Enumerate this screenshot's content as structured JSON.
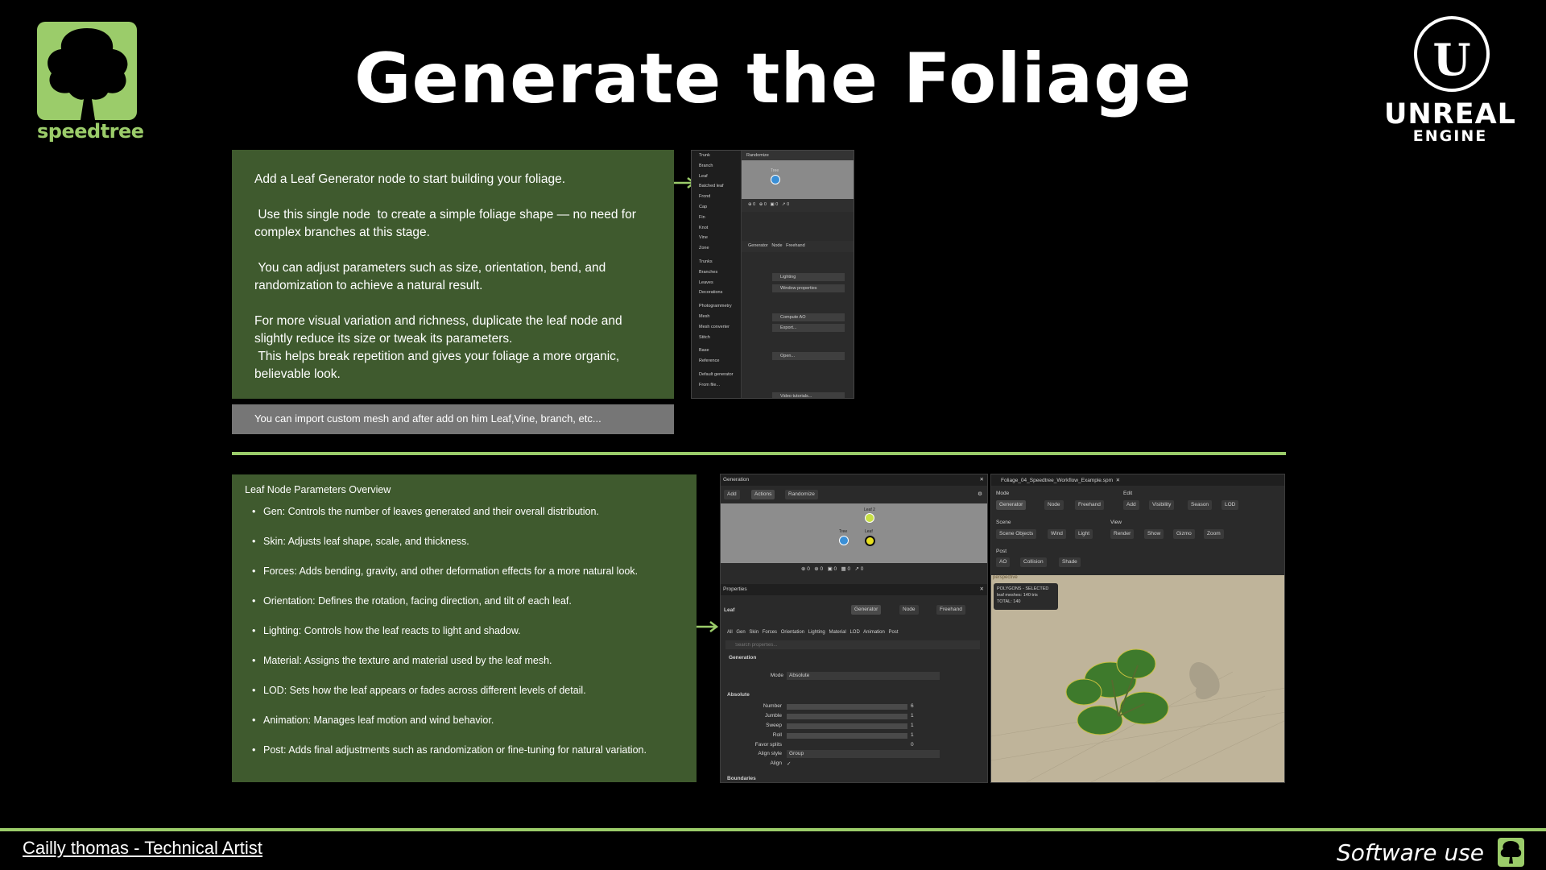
{
  "title": "Generate the Foliage",
  "logos": {
    "speedtree_word": "speedtree",
    "unreal_line1": "UNREAL",
    "unreal_line2": "ENGINE"
  },
  "panel_top": {
    "paragraphs": [
      "Add a Leaf Generator node to start building your foliage.",
      " Use this single node  to create a simple foliage shape — no need for complex branches at this stage.",
      " You can adjust parameters such as size, orientation, bend, and randomization to achieve a natural result.",
      "For more visual variation and richness, duplicate the leaf node and slightly reduce its size or tweak its parameters.\n This helps break repetition and gives your foliage a more organic, believable look."
    ],
    "note": "You can import custom mesh  and after add on him Leaf,Vine, branch, etc..."
  },
  "panel_bottom": {
    "heading": "Leaf Node Parameters Overview",
    "items": [
      "Gen: Controls the number of leaves generated and their overall distribution.",
      "Skin: Adjusts leaf shape, scale, and thickness.",
      "Forces: Adds bending, gravity, and other deformation effects for a more natural look.",
      "Orientation: Defines the rotation, facing direction, and tilt of each leaf.",
      "Lighting: Controls how the leaf reacts to light and shadow.",
      "Material: Assigns the texture and material used by the leaf mesh.",
      "LOD: Sets how the leaf appears or fades across different levels of detail.",
      "Animation: Manages leaf motion and wind behavior.",
      "Post: Adds final adjustments such as randomization or fine-tuning for natural variation."
    ]
  },
  "shot1": {
    "menu": [
      "Trunk",
      "Branch",
      "Leaf",
      "Batched leaf",
      "Frond",
      "Cap",
      "Fin",
      "Knot",
      "Vine",
      "Zone",
      "",
      "Trunks",
      "Branches",
      "Leaves",
      "Decorations",
      "",
      "Photogrammetry",
      "Mesh",
      "Mesh converter",
      "Stitch",
      "",
      "Base",
      "Reference",
      "",
      "Default generator",
      "From file..."
    ],
    "randomize": "Randomize",
    "tree": "Tree",
    "tabs": [
      "Generator",
      "Node",
      "Freehand"
    ],
    "rows": [
      "Lighting",
      "Window properties",
      "Compute AO",
      "Export...",
      "Open...",
      "Video tutorials..."
    ]
  },
  "shot2": {
    "title": "Generation",
    "toolbar": [
      "Add",
      "Actions",
      "Randomize"
    ],
    "nodes": [
      "Leaf 2",
      "Tree",
      "Leaf"
    ],
    "props_title": "Properties",
    "leaf_label": "Leaf",
    "tabs": [
      "Generator",
      "Node",
      "Freehand"
    ],
    "subtabs": [
      "All",
      "Gen",
      "Skin",
      "Forces",
      "Orientation",
      "Lighting",
      "Material",
      "LOD",
      "Animation",
      "Post"
    ],
    "search_placeholder": "Search properties...",
    "section": "Generation",
    "mode_label": "Mode",
    "mode_value": "Absolute",
    "absolute": "Absolute",
    "params": [
      {
        "label": "Number",
        "value": "6"
      },
      {
        "label": "Jumble",
        "value": "1"
      },
      {
        "label": "Sweep",
        "value": "1"
      },
      {
        "label": "Roll",
        "value": "1"
      },
      {
        "label": "Favor splits",
        "value": "0"
      }
    ],
    "align_style_label": "Align style",
    "align_style_value": "Group",
    "align_label": "Align",
    "boundaries": "Boundaries"
  },
  "shot3": {
    "tab_title": "Foliage_04_Speedtree_Workflow_Example.spm",
    "mode": "Mode",
    "edit": "Edit",
    "mode_buttons": [
      "Generator",
      "Node",
      "Freehand"
    ],
    "edit_buttons": [
      "Add",
      "Visibility",
      "Season",
      "LOD"
    ],
    "scene": "Scene",
    "view": "View",
    "scene_buttons": [
      "Scene Objects",
      "Wind",
      "Light"
    ],
    "view_buttons": [
      "Render",
      "Show",
      "Gizmo",
      "Zoom"
    ],
    "post": "Post",
    "post_buttons": [
      "AO",
      "Collision",
      "Shade"
    ],
    "viewport": "perspective",
    "stats_title": "POLYGONS - SELECTED",
    "stats_line1": "leaf meshes:  140 tris",
    "stats_line2": "TOTAL:  140"
  },
  "footer": {
    "author": "Cailly thomas - Technical Artist",
    "right": "Software use"
  },
  "colors": {
    "accent": "#9bcc6a",
    "panel": "#3f5a2e",
    "note": "#767676"
  }
}
